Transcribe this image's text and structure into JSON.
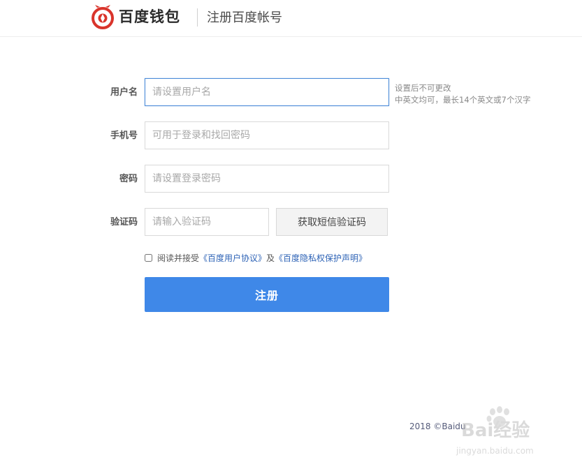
{
  "header": {
    "brand": "百度钱包",
    "subtitle": "注册百度帐号"
  },
  "form": {
    "username": {
      "label": "用户名",
      "placeholder": "请设置用户名",
      "value": "",
      "hint_line1": "设置后不可更改",
      "hint_line2": "中英文均可，最长14个英文或7个汉字"
    },
    "phone": {
      "label": "手机号",
      "placeholder": "可用于登录和找回密码",
      "value": ""
    },
    "password": {
      "label": "密码",
      "placeholder": "请设置登录密码",
      "value": ""
    },
    "captcha": {
      "label": "验证码",
      "placeholder": "请输入验证码",
      "value": "",
      "sms_button": "获取短信验证码"
    },
    "agreement": {
      "checked": false,
      "prefix": "阅读并接受",
      "link1": "《百度用户协议》",
      "conjunction": "及",
      "link2": "《百度隐私权保护声明》"
    },
    "submit_label": "注册"
  },
  "footer": {
    "copyright": "2018 ©Baidu"
  },
  "watermark": {
    "text": "Bai经验",
    "url": "jingyan.baidu.com"
  },
  "colors": {
    "brand_red": "#d9342b",
    "primary_blue": "#3f88e8",
    "link_blue": "#2e63b6",
    "focus_border": "#4a8ad8"
  },
  "icons": {
    "logo": "baidu-wallet-logo-icon",
    "watermark": "baidu-paw-watermark-icon"
  }
}
